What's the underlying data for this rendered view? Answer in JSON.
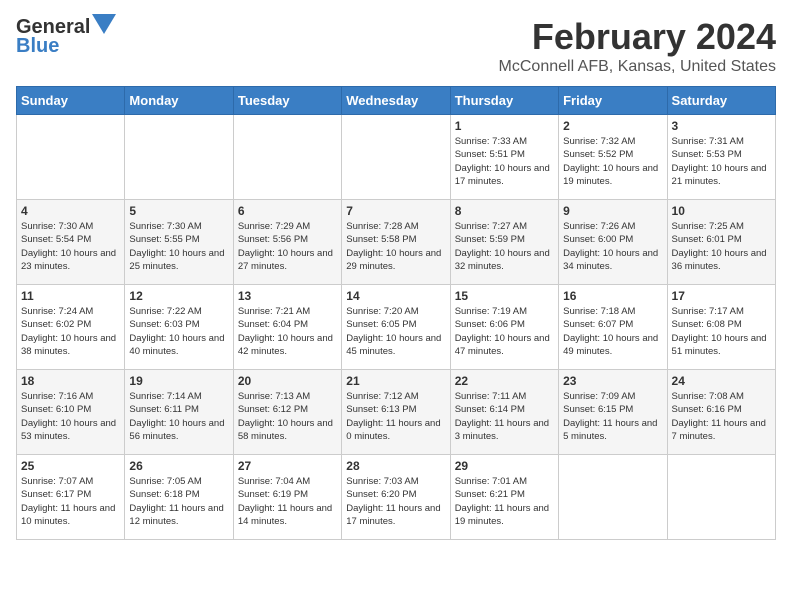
{
  "header": {
    "logo_line1_general": "General",
    "logo_line2_blue": "Blue",
    "month_title": "February 2024",
    "location": "McConnell AFB, Kansas, United States"
  },
  "weekdays": [
    "Sunday",
    "Monday",
    "Tuesday",
    "Wednesday",
    "Thursday",
    "Friday",
    "Saturday"
  ],
  "weeks": [
    [
      {
        "day": "",
        "info": ""
      },
      {
        "day": "",
        "info": ""
      },
      {
        "day": "",
        "info": ""
      },
      {
        "day": "",
        "info": ""
      },
      {
        "day": "1",
        "info": "Sunrise: 7:33 AM\nSunset: 5:51 PM\nDaylight: 10 hours\nand 17 minutes."
      },
      {
        "day": "2",
        "info": "Sunrise: 7:32 AM\nSunset: 5:52 PM\nDaylight: 10 hours\nand 19 minutes."
      },
      {
        "day": "3",
        "info": "Sunrise: 7:31 AM\nSunset: 5:53 PM\nDaylight: 10 hours\nand 21 minutes."
      }
    ],
    [
      {
        "day": "4",
        "info": "Sunrise: 7:30 AM\nSunset: 5:54 PM\nDaylight: 10 hours\nand 23 minutes."
      },
      {
        "day": "5",
        "info": "Sunrise: 7:30 AM\nSunset: 5:55 PM\nDaylight: 10 hours\nand 25 minutes."
      },
      {
        "day": "6",
        "info": "Sunrise: 7:29 AM\nSunset: 5:56 PM\nDaylight: 10 hours\nand 27 minutes."
      },
      {
        "day": "7",
        "info": "Sunrise: 7:28 AM\nSunset: 5:58 PM\nDaylight: 10 hours\nand 29 minutes."
      },
      {
        "day": "8",
        "info": "Sunrise: 7:27 AM\nSunset: 5:59 PM\nDaylight: 10 hours\nand 32 minutes."
      },
      {
        "day": "9",
        "info": "Sunrise: 7:26 AM\nSunset: 6:00 PM\nDaylight: 10 hours\nand 34 minutes."
      },
      {
        "day": "10",
        "info": "Sunrise: 7:25 AM\nSunset: 6:01 PM\nDaylight: 10 hours\nand 36 minutes."
      }
    ],
    [
      {
        "day": "11",
        "info": "Sunrise: 7:24 AM\nSunset: 6:02 PM\nDaylight: 10 hours\nand 38 minutes."
      },
      {
        "day": "12",
        "info": "Sunrise: 7:22 AM\nSunset: 6:03 PM\nDaylight: 10 hours\nand 40 minutes."
      },
      {
        "day": "13",
        "info": "Sunrise: 7:21 AM\nSunset: 6:04 PM\nDaylight: 10 hours\nand 42 minutes."
      },
      {
        "day": "14",
        "info": "Sunrise: 7:20 AM\nSunset: 6:05 PM\nDaylight: 10 hours\nand 45 minutes."
      },
      {
        "day": "15",
        "info": "Sunrise: 7:19 AM\nSunset: 6:06 PM\nDaylight: 10 hours\nand 47 minutes."
      },
      {
        "day": "16",
        "info": "Sunrise: 7:18 AM\nSunset: 6:07 PM\nDaylight: 10 hours\nand 49 minutes."
      },
      {
        "day": "17",
        "info": "Sunrise: 7:17 AM\nSunset: 6:08 PM\nDaylight: 10 hours\nand 51 minutes."
      }
    ],
    [
      {
        "day": "18",
        "info": "Sunrise: 7:16 AM\nSunset: 6:10 PM\nDaylight: 10 hours\nand 53 minutes."
      },
      {
        "day": "19",
        "info": "Sunrise: 7:14 AM\nSunset: 6:11 PM\nDaylight: 10 hours\nand 56 minutes."
      },
      {
        "day": "20",
        "info": "Sunrise: 7:13 AM\nSunset: 6:12 PM\nDaylight: 10 hours\nand 58 minutes."
      },
      {
        "day": "21",
        "info": "Sunrise: 7:12 AM\nSunset: 6:13 PM\nDaylight: 11 hours\nand 0 minutes."
      },
      {
        "day": "22",
        "info": "Sunrise: 7:11 AM\nSunset: 6:14 PM\nDaylight: 11 hours\nand 3 minutes."
      },
      {
        "day": "23",
        "info": "Sunrise: 7:09 AM\nSunset: 6:15 PM\nDaylight: 11 hours\nand 5 minutes."
      },
      {
        "day": "24",
        "info": "Sunrise: 7:08 AM\nSunset: 6:16 PM\nDaylight: 11 hours\nand 7 minutes."
      }
    ],
    [
      {
        "day": "25",
        "info": "Sunrise: 7:07 AM\nSunset: 6:17 PM\nDaylight: 11 hours\nand 10 minutes."
      },
      {
        "day": "26",
        "info": "Sunrise: 7:05 AM\nSunset: 6:18 PM\nDaylight: 11 hours\nand 12 minutes."
      },
      {
        "day": "27",
        "info": "Sunrise: 7:04 AM\nSunset: 6:19 PM\nDaylight: 11 hours\nand 14 minutes."
      },
      {
        "day": "28",
        "info": "Sunrise: 7:03 AM\nSunset: 6:20 PM\nDaylight: 11 hours\nand 17 minutes."
      },
      {
        "day": "29",
        "info": "Sunrise: 7:01 AM\nSunset: 6:21 PM\nDaylight: 11 hours\nand 19 minutes."
      },
      {
        "day": "",
        "info": ""
      },
      {
        "day": "",
        "info": ""
      }
    ]
  ]
}
